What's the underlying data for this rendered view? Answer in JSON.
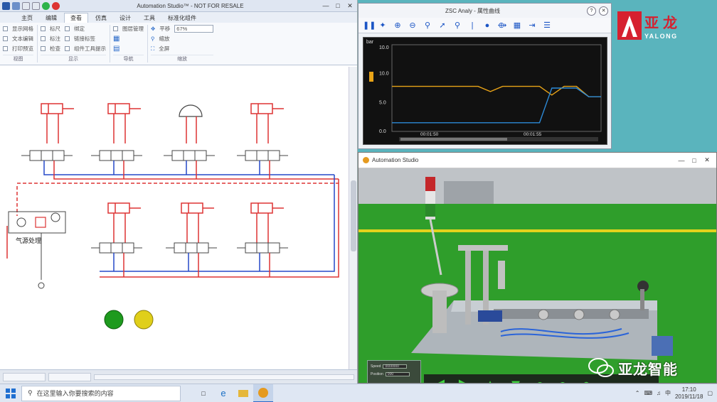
{
  "left_app": {
    "title": "Automation Studio™ - NOT FOR RESALE",
    "tabs": [
      "主页",
      "编辑",
      "查看",
      "仿真",
      "设计",
      "工具",
      "标准化组件"
    ],
    "active_tab": 2,
    "ribbon": {
      "g1": [
        "显示网格",
        "文本编辑",
        "打印预览"
      ],
      "g2": [
        "标尺",
        "标注",
        "检查"
      ],
      "g3": [
        "绑定",
        "链接标签",
        "组件工具提示",
        "图层管理"
      ],
      "g4": [
        "平移",
        "缩放",
        "全屏"
      ],
      "zoom": "67%",
      "group_names": [
        "视图",
        "显示",
        "导航",
        "缩放"
      ]
    }
  },
  "diagram": {
    "label_filter": "气源处理"
  },
  "chart_win": {
    "title": "ZSC Analy - 属性曲线"
  },
  "chart_data": {
    "type": "line",
    "ylabel": "bar",
    "yticks": [
      "10.0",
      "10.0",
      "5.0",
      "0.0"
    ],
    "xticks": [
      "00:01:50",
      "00:01:55"
    ],
    "series": [
      {
        "color": "#e8a317",
        "values": [
          5.2,
          5.2,
          5.2,
          5.2,
          5.2,
          5.2,
          5.2,
          5.2,
          4.6,
          5.2,
          5.2,
          5.2,
          5.2,
          4.2,
          5.2,
          5.2,
          4.0,
          4.0
        ]
      },
      {
        "color": "#2c8ad8",
        "values": [
          1.0,
          1.0,
          1.0,
          1.0,
          1.0,
          1.0,
          1.0,
          1.0,
          1.0,
          1.0,
          1.0,
          1.0,
          1.0,
          5.0,
          5.0,
          5.0,
          4.0,
          4.0
        ]
      }
    ]
  },
  "logo": {
    "cn": "亚龙",
    "en": "YALONG",
    "color": "#d6202f"
  },
  "sim_win": {
    "title": "Automation Studio",
    "panel": [
      "Speed",
      "Position"
    ],
    "panel_values": [
      "0000000",
      "000"
    ]
  },
  "watermark": {
    "text": "亚龙智能"
  },
  "taskbar": {
    "search_placeholder": "在这里输入你要搜索的内容",
    "time": "17:10",
    "date": "2019/11/18",
    "ime": "中"
  }
}
